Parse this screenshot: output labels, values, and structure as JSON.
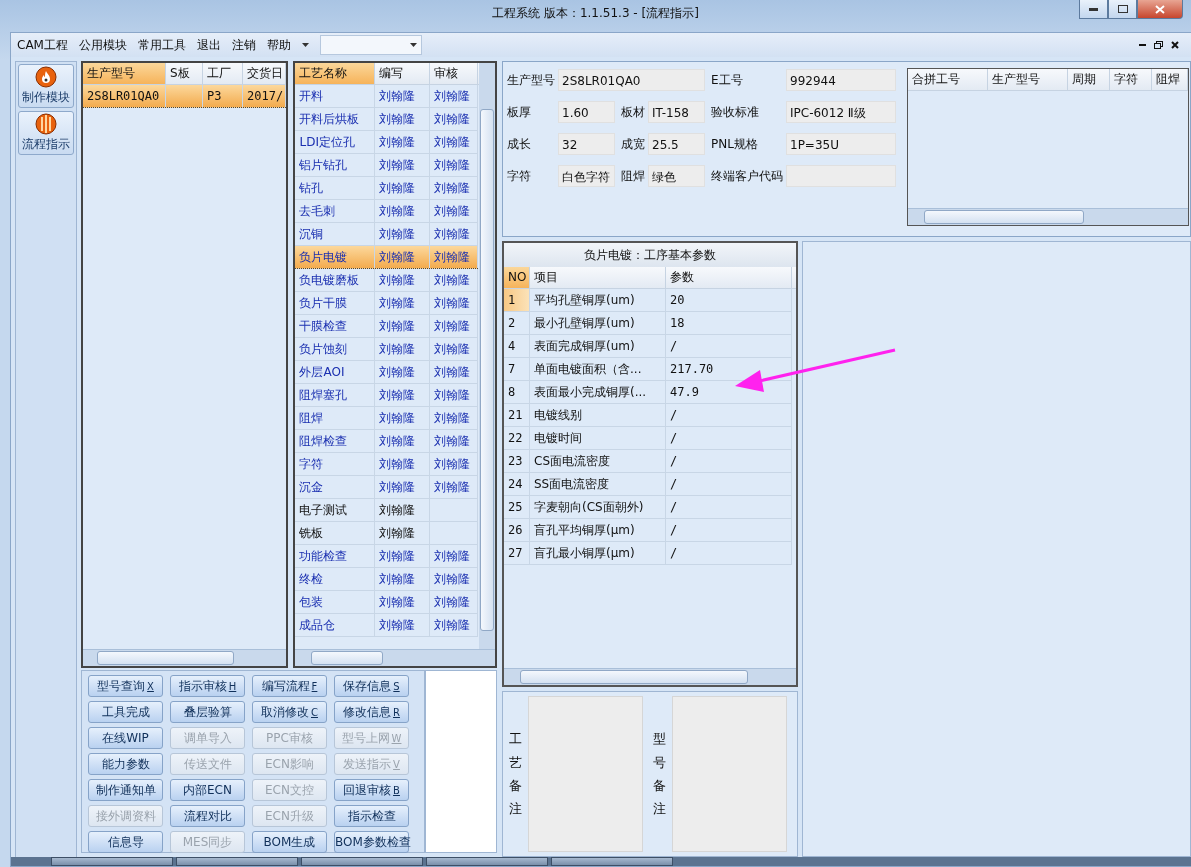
{
  "window": {
    "title": "工程系统   版本：1.1.51.3 - [流程指示]"
  },
  "menu": [
    {
      "label": "CAM工程"
    },
    {
      "label": "公用模块"
    },
    {
      "label": "常用工具"
    },
    {
      "label": "退出"
    },
    {
      "label": "注销"
    },
    {
      "label": "帮助"
    }
  ],
  "sidebar": [
    {
      "label": "制作模块",
      "kind": "flame"
    },
    {
      "label": "流程指示",
      "kind": "globe"
    }
  ],
  "orders": {
    "columns": [
      "生产型号",
      "S板",
      "工厂",
      "交货日"
    ],
    "rows": [
      {
        "model": "2S8LR01QA0",
        "factory": "P3",
        "delivery": "2017/",
        "selected": true
      }
    ]
  },
  "process": {
    "columns": [
      "工艺名称",
      "编写",
      "审核"
    ],
    "rows": [
      {
        "name": "开料",
        "writer": "刘翰隆",
        "reviewer": "刘翰隆",
        "approved": true,
        "selected": false
      },
      {
        "name": "开料后烘板",
        "writer": "刘翰隆",
        "reviewer": "刘翰隆",
        "approved": true,
        "selected": false
      },
      {
        "name": "LDI定位孔",
        "writer": "刘翰隆",
        "reviewer": "刘翰隆",
        "approved": true,
        "selected": false
      },
      {
        "name": "铝片钻孔",
        "writer": "刘翰隆",
        "reviewer": "刘翰隆",
        "approved": true,
        "selected": false
      },
      {
        "name": "钻孔",
        "writer": "刘翰隆",
        "reviewer": "刘翰隆",
        "approved": true,
        "selected": false
      },
      {
        "name": "去毛刺",
        "writer": "刘翰隆",
        "reviewer": "刘翰隆",
        "approved": true,
        "selected": false
      },
      {
        "name": "沉铜",
        "writer": "刘翰隆",
        "reviewer": "刘翰隆",
        "approved": true,
        "selected": false
      },
      {
        "name": "负片电镀",
        "writer": "刘翰隆",
        "reviewer": "刘翰隆",
        "approved": true,
        "selected": true
      },
      {
        "name": "负电镀磨板",
        "writer": "刘翰隆",
        "reviewer": "刘翰隆",
        "approved": true,
        "selected": false
      },
      {
        "name": "负片干膜",
        "writer": "刘翰隆",
        "reviewer": "刘翰隆",
        "approved": true,
        "selected": false
      },
      {
        "name": "干膜检查",
        "writer": "刘翰隆",
        "reviewer": "刘翰隆",
        "approved": true,
        "selected": false
      },
      {
        "name": "负片蚀刻",
        "writer": "刘翰隆",
        "reviewer": "刘翰隆",
        "approved": true,
        "selected": false
      },
      {
        "name": "外层AOI",
        "writer": "刘翰隆",
        "reviewer": "刘翰隆",
        "approved": true,
        "selected": false
      },
      {
        "name": "阻焊塞孔",
        "writer": "刘翰隆",
        "reviewer": "刘翰隆",
        "approved": true,
        "selected": false
      },
      {
        "name": "阻焊",
        "writer": "刘翰隆",
        "reviewer": "刘翰隆",
        "approved": true,
        "selected": false
      },
      {
        "name": "阻焊检查",
        "writer": "刘翰隆",
        "reviewer": "刘翰隆",
        "approved": true,
        "selected": false
      },
      {
        "name": "字符",
        "writer": "刘翰隆",
        "reviewer": "刘翰隆",
        "approved": true,
        "selected": false
      },
      {
        "name": "沉金",
        "writer": "刘翰隆",
        "reviewer": "刘翰隆",
        "approved": true,
        "selected": false
      },
      {
        "name": "电子测试",
        "writer": "刘翰隆",
        "approved": false,
        "selected": false
      },
      {
        "name": "铣板",
        "writer": "刘翰隆",
        "approved": false,
        "selected": false
      },
      {
        "name": "功能检查",
        "writer": "刘翰隆",
        "reviewer": "刘翰隆",
        "approved": true,
        "selected": false
      },
      {
        "name": "终检",
        "writer": "刘翰隆",
        "reviewer": "刘翰隆",
        "approved": true,
        "selected": false
      },
      {
        "name": "包装",
        "writer": "刘翰隆",
        "reviewer": "刘翰隆",
        "approved": true,
        "selected": false
      },
      {
        "name": "成品仓",
        "writer": "刘翰隆",
        "reviewer": "刘翰隆",
        "approved": true,
        "selected": false
      }
    ]
  },
  "info": {
    "fields": [
      {
        "label": "生产型号",
        "value": "2S8LR01QA0"
      },
      {
        "label": "E工号",
        "value": "992944"
      },
      {
        "label": "板厚",
        "value": "1.60"
      },
      {
        "label": "板材",
        "value": "IT-158"
      },
      {
        "label": "验收标准",
        "value": "IPC-6012 Ⅱ级"
      },
      {
        "label": "成长",
        "value": "32"
      },
      {
        "label": "成宽",
        "value": "25.5"
      },
      {
        "label": "PNL规格",
        "value": "1P=35U"
      },
      {
        "label": "字符",
        "value": "白色字符"
      },
      {
        "label": "阻焊",
        "value": "绿色"
      },
      {
        "label": "终端客户代码"
      }
    ]
  },
  "merge_table": {
    "columns": [
      "合拼工号",
      "生产型号",
      "周期",
      "字符",
      "阻焊"
    ]
  },
  "params": {
    "title": "负片电镀：工序基本参数",
    "columns": [
      "NO",
      "项目",
      "参数"
    ],
    "rows": [
      {
        "no": "1",
        "item": "平均孔壁铜厚(um)",
        "value": "20",
        "selected": true
      },
      {
        "no": "2",
        "item": "最小孔壁铜厚(um)",
        "value": "18",
        "selected": false
      },
      {
        "no": "4",
        "item": "表面完成铜厚(um)",
        "value": "/",
        "selected": false
      },
      {
        "no": "7",
        "item": "单面电镀面积（含...",
        "value": "217.70",
        "selected": false
      },
      {
        "no": "8",
        "item": "表面最小完成铜厚(...",
        "value": "47.9",
        "selected": false
      },
      {
        "no": "21",
        "item": "电镀线别",
        "value": "/",
        "selected": false
      },
      {
        "no": "22",
        "item": "电镀时间",
        "value": "/",
        "selected": false
      },
      {
        "no": "23",
        "item": "CS面电流密度",
        "value": "/",
        "selected": false
      },
      {
        "no": "24",
        "item": "SS面电流密度",
        "value": "/",
        "selected": false
      },
      {
        "no": "25",
        "item": "字麦朝向(CS面朝外)",
        "value": "/",
        "selected": false
      },
      {
        "no": "26",
        "item": "盲孔平均铜厚(μm)",
        "value": "/",
        "selected": false
      },
      {
        "no": "27",
        "item": "盲孔最小铜厚(μm)",
        "value": "/",
        "selected": false
      }
    ]
  },
  "notes": [
    {
      "label": "工艺备注"
    },
    {
      "label": "型号备注"
    }
  ],
  "actions": [
    {
      "label": "型号查询",
      "shortcut": "X",
      "disabled": false
    },
    {
      "label": "指示审核",
      "shortcut": "H",
      "disabled": false
    },
    {
      "label": "编写流程",
      "shortcut": "F",
      "disabled": false
    },
    {
      "label": "保存信息",
      "shortcut": "S",
      "disabled": false
    },
    {
      "label": "工具完成",
      "disabled": false
    },
    {
      "label": "叠层验算",
      "disabled": false
    },
    {
      "label": "取消修改",
      "shortcut": "C",
      "disabled": false
    },
    {
      "label": "修改信息",
      "shortcut": "R",
      "disabled": false
    },
    {
      "label": "在线WIP",
      "disabled": false
    },
    {
      "label": "调单导入",
      "disabled": true
    },
    {
      "label": "PPC审核",
      "disabled": true
    },
    {
      "label": "型号上网",
      "shortcut": "W",
      "disabled": true
    },
    {
      "label": "能力参数",
      "disabled": false
    },
    {
      "label": "传送文件",
      "disabled": true
    },
    {
      "label": "ECN影响",
      "disabled": true
    },
    {
      "label": "发送指示",
      "shortcut": "V",
      "disabled": true
    },
    {
      "label": "制作通知单",
      "disabled": false
    },
    {
      "label": "内部ECN",
      "disabled": false
    },
    {
      "label": "ECN文控",
      "disabled": true
    },
    {
      "label": "回退审核",
      "shortcut": "B",
      "disabled": false
    },
    {
      "label": "接外调资料",
      "disabled": true
    },
    {
      "label": "流程对比",
      "disabled": false
    },
    {
      "label": "ECN升级",
      "disabled": true
    },
    {
      "label": "指示检查",
      "disabled": false
    },
    {
      "label": "信息导",
      "disabled": false
    },
    {
      "label": "MES同步",
      "disabled": true
    },
    {
      "label": "BOM生成",
      "disabled": false
    },
    {
      "label": "BOM参数检查",
      "disabled": false
    }
  ]
}
